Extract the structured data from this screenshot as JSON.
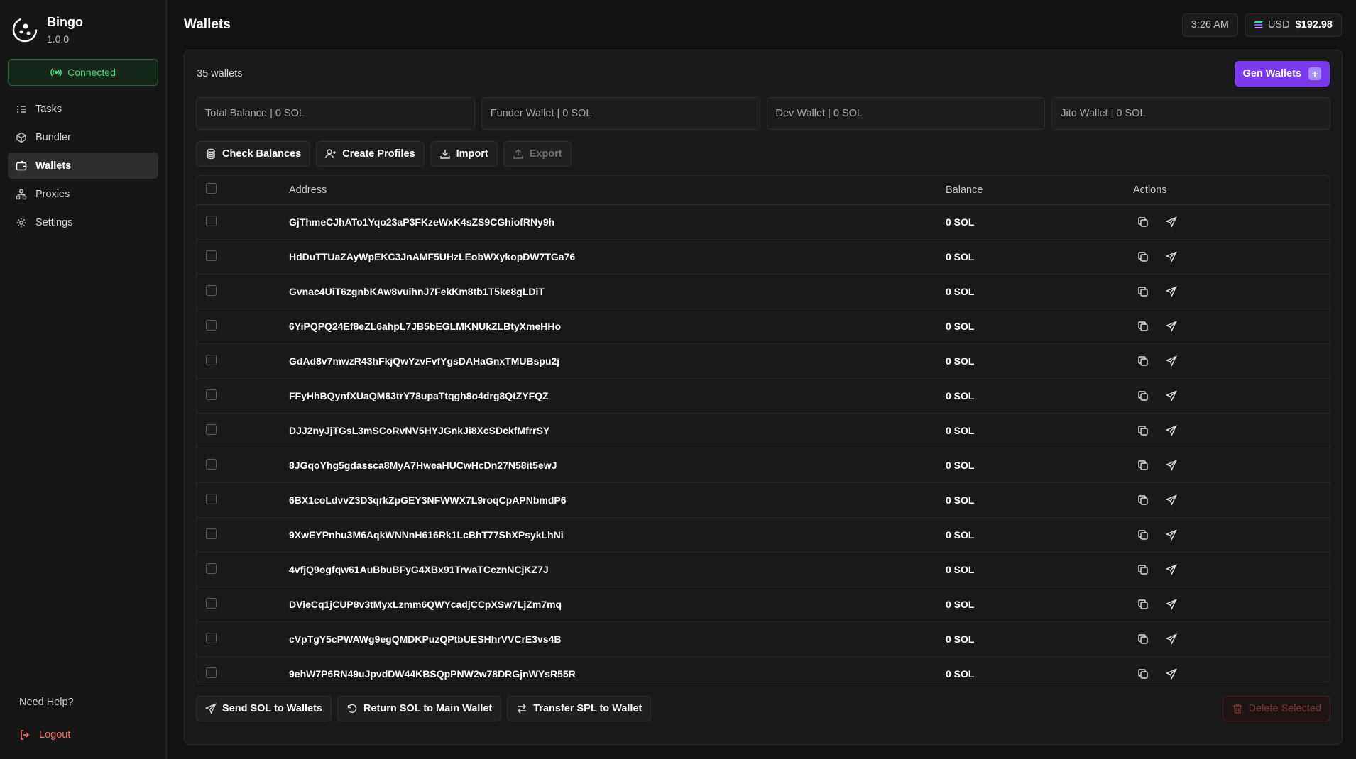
{
  "app": {
    "name": "Bingo",
    "version": "1.0.0",
    "status": "Connected"
  },
  "nav": [
    {
      "label": "Tasks",
      "icon": "list-check-icon",
      "active": false
    },
    {
      "label": "Bundler",
      "icon": "package-icon",
      "active": false
    },
    {
      "label": "Wallets",
      "icon": "wallet-icon",
      "active": true
    },
    {
      "label": "Proxies",
      "icon": "network-icon",
      "active": false
    },
    {
      "label": "Settings",
      "icon": "gear-icon",
      "active": false
    }
  ],
  "sidebar_footer": {
    "help": "Need Help?",
    "logout": "Logout"
  },
  "header": {
    "title": "Wallets",
    "time": "3:26 AM",
    "currency": "USD",
    "price": "$192.98"
  },
  "wallets": {
    "count_label": "35 wallets",
    "gen_label": "Gen Wallets",
    "stats": [
      "Total Balance | 0 SOL",
      "Funder Wallet | 0 SOL",
      "Dev Wallet | 0 SOL",
      "Jito Wallet | 0 SOL"
    ],
    "actions": {
      "check": "Check Balances",
      "profiles": "Create Profiles",
      "import": "Import",
      "export": "Export"
    },
    "columns": {
      "address": "Address",
      "balance": "Balance",
      "actions": "Actions"
    },
    "rows": [
      {
        "address": "GjThmeCJhATo1Yqo23aP3FKzeWxK4sZS9CGhiofRNy9h",
        "balance": "0 SOL"
      },
      {
        "address": "HdDuTTUaZAyWpEKC3JnAMF5UHzLEobWXykopDW7TGa76",
        "balance": "0 SOL"
      },
      {
        "address": "Gvnac4UiT6zgnbKAw8vuihnJ7FekKm8tb1T5ke8gLDiT",
        "balance": "0 SOL"
      },
      {
        "address": "6YiPQPQ24Ef8eZL6ahpL7JB5bEGLMKNUkZLBtyXmeHHo",
        "balance": "0 SOL"
      },
      {
        "address": "GdAd8v7mwzR43hFkjQwYzvFvfYgsDAHaGnxTMUBspu2j",
        "balance": "0 SOL"
      },
      {
        "address": "FFyHhBQynfXUaQM83trY78upaTtqgh8o4drg8QtZYFQZ",
        "balance": "0 SOL"
      },
      {
        "address": "DJJ2nyJjTGsL3mSCoRvNV5HYJGnkJi8XcSDckfMfrrSY",
        "balance": "0 SOL"
      },
      {
        "address": "8JGqoYhg5gdassca8MyA7HweaHUCwHcDn27N58it5ewJ",
        "balance": "0 SOL"
      },
      {
        "address": "6BX1coLdvvZ3D3qrkZpGEY3NFWWX7L9roqCpAPNbmdP6",
        "balance": "0 SOL"
      },
      {
        "address": "9XwEYPnhu3M6AqkWNNnH616Rk1LcBhT77ShXPsykLhNi",
        "balance": "0 SOL"
      },
      {
        "address": "4vfjQ9ogfqw61AuBbuBFyG4XBx91TrwaTCcznNCjKZ7J",
        "balance": "0 SOL"
      },
      {
        "address": "DVieCq1jCUP8v3tMyxLzmm6QWYcadjCCpXSw7LjZm7mq",
        "balance": "0 SOL"
      },
      {
        "address": "cVpTgY5cPWAWg9egQMDKPuzQPtbUESHhrVVCrE3vs4B",
        "balance": "0 SOL"
      },
      {
        "address": "9ehW7P6RN49uJpvdDW44KBSQpPNW2w78DRGjnWYsR55R",
        "balance": "0 SOL"
      }
    ],
    "footer": {
      "send": "Send SOL to Wallets",
      "return": "Return SOL to Main Wallet",
      "transfer": "Transfer SPL to Wallet",
      "delete": "Delete Selected"
    }
  },
  "colors": {
    "accent": "#7c3aed",
    "connected": "#4ade80",
    "danger": "#f87171"
  }
}
